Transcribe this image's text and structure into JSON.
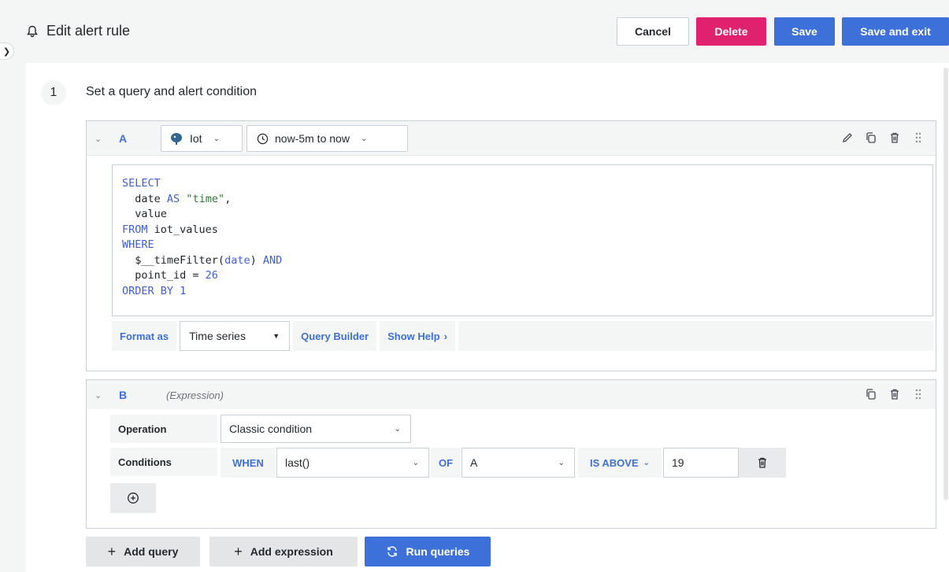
{
  "header": {
    "title": "Edit alert rule",
    "cancel_label": "Cancel",
    "delete_label": "Delete",
    "save_label": "Save",
    "save_exit_label": "Save and exit"
  },
  "step": {
    "number": "1",
    "title": "Set a query and alert condition"
  },
  "query_a": {
    "letter": "A",
    "datasource": "Iot",
    "time_range": "now-5m to now",
    "sql": {
      "l1": "SELECT",
      "l2_col": "date",
      "l2_as": "AS",
      "l2_alias": "\"time\"",
      "l3": "value",
      "l4_from": "FROM",
      "l4_table": "iot_values",
      "l5": "WHERE",
      "l6_fn": "$__timeFilter(",
      "l6_arg": "date",
      "l6_close": ")",
      "l6_and": "AND",
      "l7_col": "point_id = ",
      "l7_val": "26",
      "l8_kw": "ORDER BY",
      "l8_val": "1"
    },
    "format_as_label": "Format as",
    "format_value": "Time series",
    "query_builder_label": "Query Builder",
    "show_help_label": "Show Help"
  },
  "query_b": {
    "letter": "B",
    "tag": "(Expression)",
    "operation_label": "Operation",
    "operation_value": "Classic condition",
    "conditions_label": "Conditions",
    "when_label": "WHEN",
    "reducer_value": "last()",
    "of_label": "OF",
    "of_value": "A",
    "evaluator_value": "IS ABOVE",
    "threshold_value": "19"
  },
  "actions": {
    "add_query_label": "Add query",
    "add_expression_label": "Add expression",
    "run_queries_label": "Run queries"
  },
  "colors": {
    "primary": "#3d71d9",
    "danger": "#e0226e"
  }
}
